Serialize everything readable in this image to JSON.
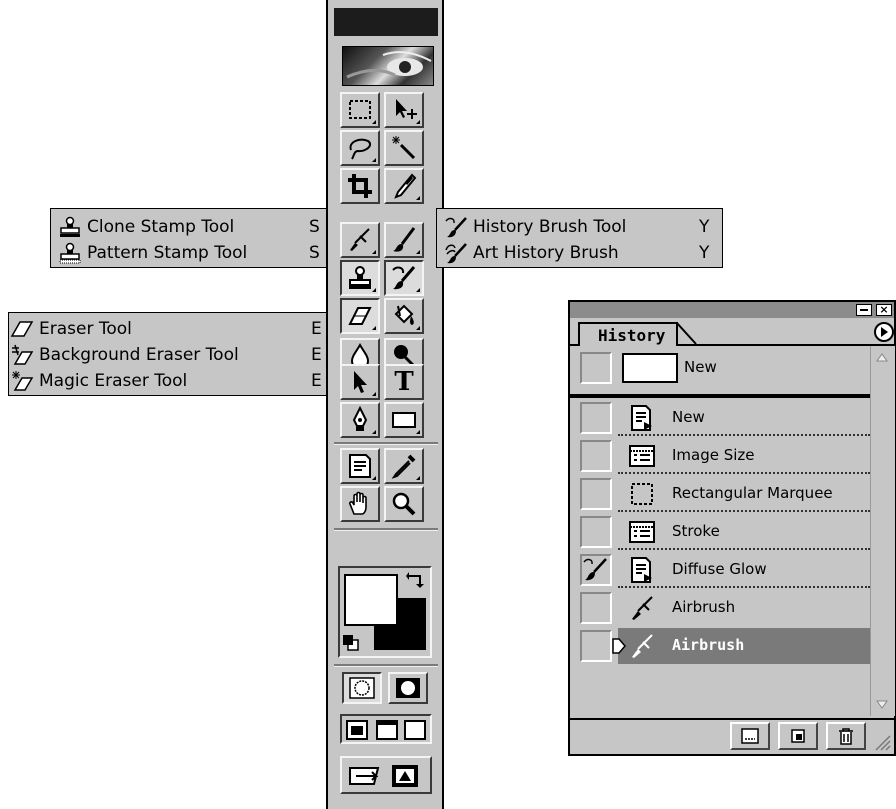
{
  "flyouts": {
    "stamp": {
      "items": [
        {
          "label": "Clone Stamp Tool",
          "key": "S",
          "icon": "clone-stamp-icon"
        },
        {
          "label": "Pattern Stamp Tool",
          "key": "S",
          "icon": "pattern-stamp-icon"
        }
      ]
    },
    "history_brush": {
      "items": [
        {
          "label": "History Brush Tool",
          "key": "Y",
          "icon": "history-brush-icon"
        },
        {
          "label": "Art History Brush",
          "key": "Y",
          "icon": "art-history-brush-icon"
        }
      ]
    },
    "eraser": {
      "items": [
        {
          "label": "Eraser Tool",
          "key": "E",
          "icon": "eraser-icon"
        },
        {
          "label": "Background Eraser Tool",
          "key": "E",
          "icon": "background-eraser-icon"
        },
        {
          "label": "Magic Eraser Tool",
          "key": "E",
          "icon": "magic-eraser-icon"
        }
      ]
    }
  },
  "toolbox": {
    "type_tool_glyph": "T",
    "tools": [
      "rectangular-marquee-icon",
      "move-icon",
      "lasso-icon",
      "magic-wand-icon",
      "crop-icon",
      "slice-icon",
      "healing-brush-icon",
      "brush-icon",
      "stamp-icon",
      "history-brush-icon",
      "eraser-icon",
      "paint-bucket-icon",
      "blur-icon",
      "dodge-icon",
      "path-selection-icon",
      "type-icon",
      "pen-icon",
      "rectangle-shape-icon",
      "notes-icon",
      "eyedropper-icon",
      "hand-icon",
      "zoom-icon"
    ]
  },
  "history": {
    "tab_label": "History",
    "snapshot_label": "New",
    "states": [
      {
        "label": "New",
        "icon": "document-icon",
        "selected": false
      },
      {
        "label": "Image Size",
        "icon": "dialog-icon",
        "selected": false
      },
      {
        "label": "Rectangular Marquee",
        "icon": "marquee-icon",
        "selected": false
      },
      {
        "label": "Stroke",
        "icon": "dialog-icon",
        "selected": false
      },
      {
        "label": "Diffuse Glow",
        "icon": "document-icon",
        "selected": false
      },
      {
        "label": "Airbrush",
        "icon": "airbrush-icon",
        "selected": false
      },
      {
        "label": "Airbrush",
        "icon": "airbrush-icon",
        "selected": true
      }
    ],
    "colors": {
      "selected_bg": "#7a7a7a",
      "selected_fg": "#ffffff",
      "panel_bg": "#c6c6c6"
    }
  }
}
